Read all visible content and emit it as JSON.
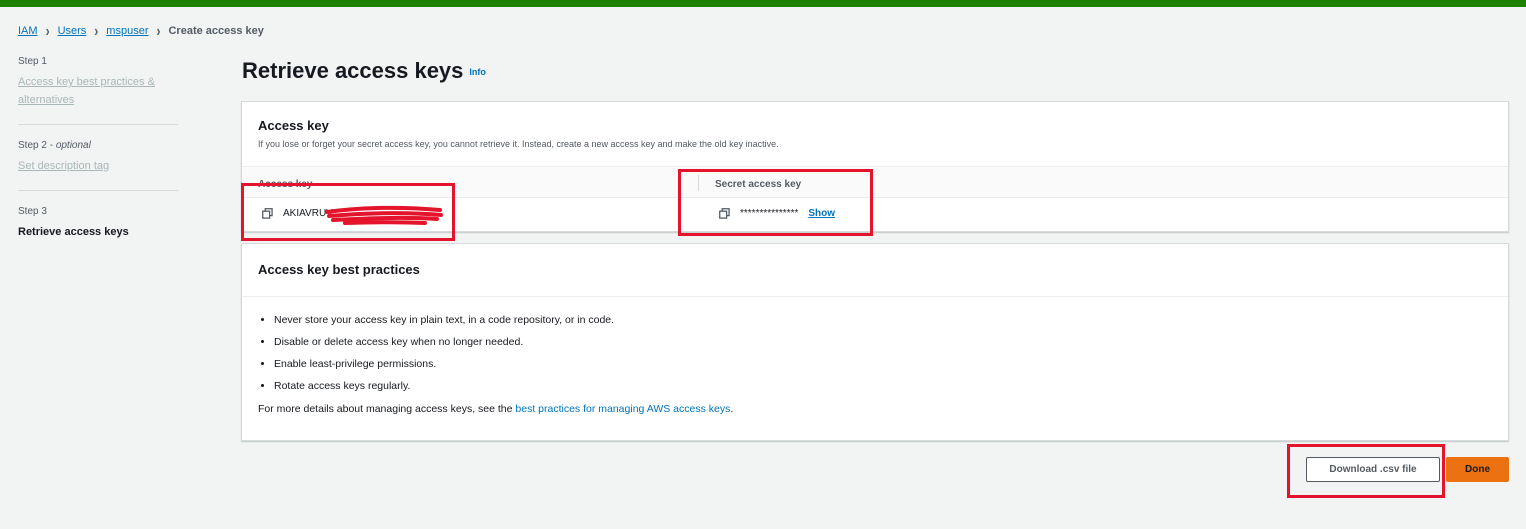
{
  "colors": {
    "header_bar": "#1d8102",
    "link": "#0073bb",
    "primary_button": "#ec7211",
    "annotation_red": "#e3142b"
  },
  "breadcrumb": {
    "items": [
      "IAM",
      "Users",
      "mspuser"
    ],
    "current": "Create access key"
  },
  "steps": [
    {
      "number": "Step 1",
      "optional": "",
      "title": "Access key best practices & alternatives"
    },
    {
      "number": "Step 2 - ",
      "optional": "optional",
      "title": "Set description tag"
    },
    {
      "number": "Step 3",
      "optional": "",
      "title": "Retrieve access keys"
    }
  ],
  "page": {
    "title": "Retrieve access keys",
    "info": "Info"
  },
  "access_key_panel": {
    "title": "Access key",
    "description": "If you lose or forget your secret access key, you cannot retrieve it. Instead, create a new access key and make the old key inactive.",
    "col_access_key": "Access key",
    "col_secret_key": "Secret access key",
    "access_key_value": "AKIAVRUV",
    "secret_key_masked": "***************",
    "show_label": "Show"
  },
  "best_practices_panel": {
    "title": "Access key best practices",
    "items": [
      "Never store your access key in plain text, in a code repository, or in code.",
      "Disable or delete access key when no longer needed.",
      "Enable least-privilege permissions.",
      "Rotate access keys regularly."
    ],
    "more_prefix": "For more details about managing access keys, see the ",
    "more_link": "best practices for managing AWS access keys",
    "more_suffix": "."
  },
  "actions": {
    "download": "Download .csv file",
    "done": "Done"
  }
}
